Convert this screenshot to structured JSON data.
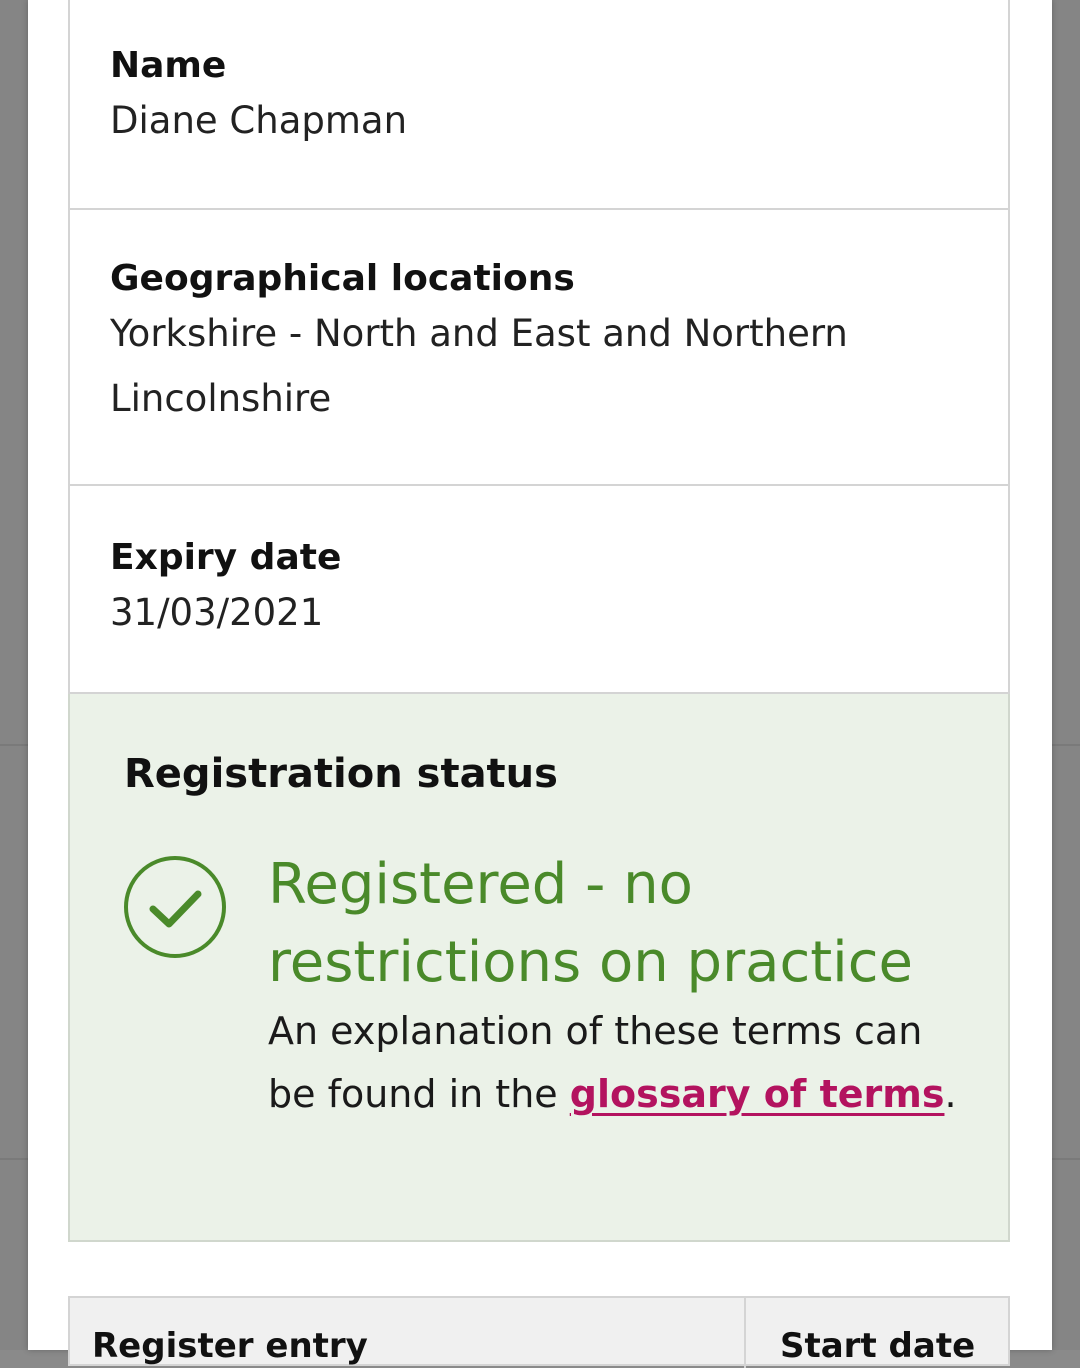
{
  "details": {
    "name": {
      "label": "Name",
      "value": "Diane Chapman"
    },
    "geographical_locations": {
      "label": "Geographical locations",
      "value": "Yorkshire - North and East and Northern Lincolnshire"
    },
    "expiry_date": {
      "label": "Expiry date",
      "value": "31/03/2021"
    }
  },
  "registration_status": {
    "title": "Registration status",
    "status_icon": "check-circle-icon",
    "status_text": "Registered - no restrictions on practice",
    "explanation_prefix": "An explanation of these terms can be found in the ",
    "glossary_link_text": "glossary of terms",
    "explanation_suffix": ".",
    "status_color": "#4a8a2a",
    "link_color": "#b3135f",
    "background_color": "#ebf2e8"
  },
  "register_table": {
    "columns": [
      "Register entry",
      "Start date"
    ]
  }
}
